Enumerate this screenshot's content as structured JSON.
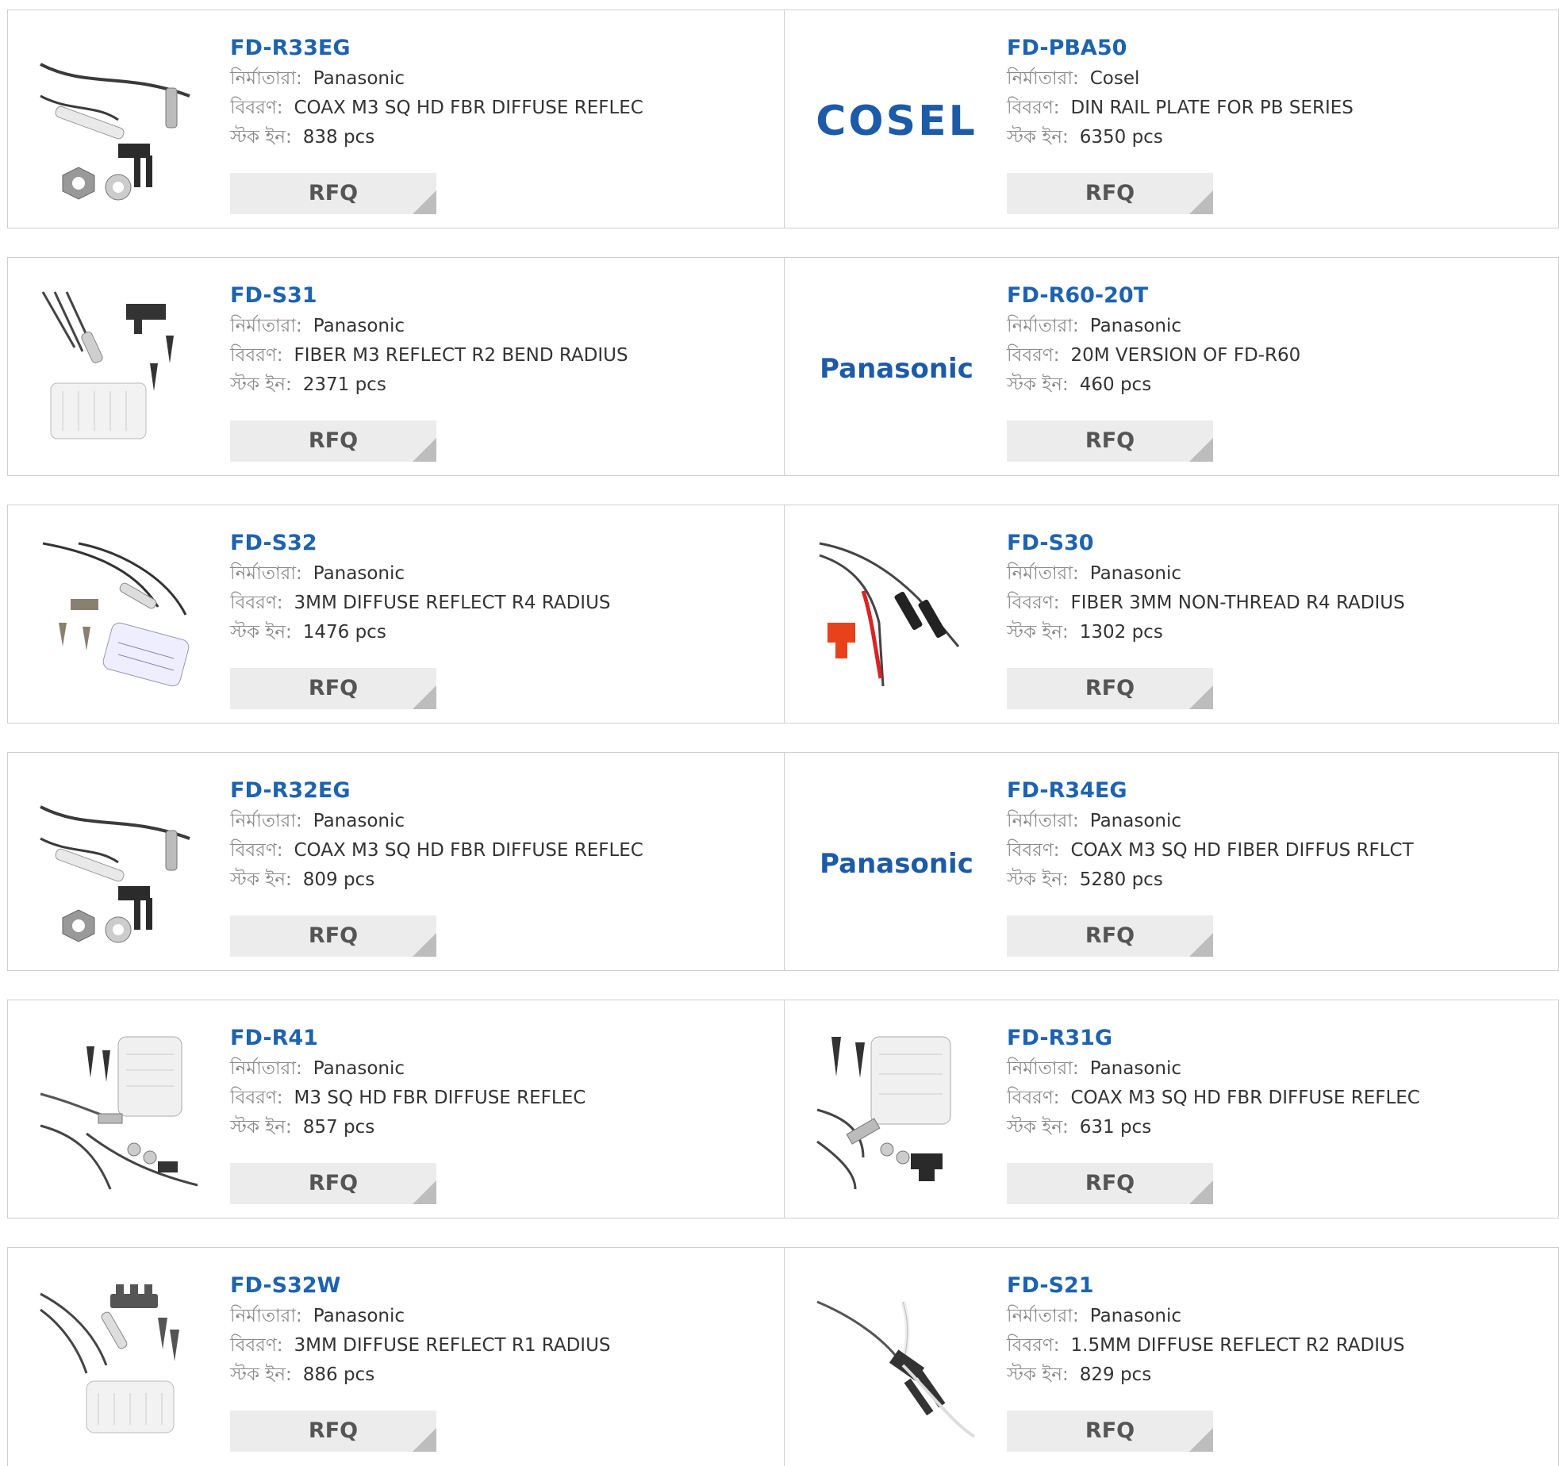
{
  "labels": {
    "manufacturer": "নির্মাতারা:",
    "description": "বিবরণ:",
    "stock": "স্টক ইন:"
  },
  "colors": {
    "part_link": "#1e63b0",
    "brand_logo": "#1d5aa8",
    "rfq_bg": "#ececec",
    "border": "#cfcfcf"
  },
  "rows": [
    {
      "left": {
        "part": "FD-R33EG",
        "manufacturer": "Panasonic",
        "description": "COAX M3 SQ HD FBR DIFFUSE REFLEC",
        "stock": "838 pcs",
        "rfq": "RFQ",
        "image": "fiber-cable-bent-head-photo"
      },
      "right": {
        "part": "FD-PBA50",
        "manufacturer": "Cosel",
        "description": "DIN RAIL PLATE FOR PB SERIES",
        "stock": "6350 pcs",
        "rfq": "RFQ",
        "image": "cosel-logo",
        "logo_text": "COSEL"
      }
    },
    {
      "left": {
        "part": "FD-S31",
        "manufacturer": "Panasonic",
        "description": "FIBER M3 REFLECT R2 BEND RADIUS",
        "stock": "2371 pcs",
        "rfq": "RFQ",
        "image": "fiber-kit-photo"
      },
      "right": {
        "part": "FD-R60-20T",
        "manufacturer": "Panasonic",
        "description": "20M VERSION OF FD-R60",
        "stock": "460 pcs",
        "rfq": "RFQ",
        "image": "panasonic-logo",
        "logo_text": "Panasonic"
      }
    },
    {
      "left": {
        "part": "FD-S32",
        "manufacturer": "Panasonic",
        "description": "3MM DIFFUSE REFLECT R4 RADIUS",
        "stock": "1476 pcs",
        "rfq": "RFQ",
        "image": "fiber-kit-photo"
      },
      "right": {
        "part": "FD-S30",
        "manufacturer": "Panasonic",
        "description": "FIBER 3MM NON-THREAD R4 RADIUS",
        "stock": "1302 pcs",
        "rfq": "RFQ",
        "image": "fiber-red-clip-photo"
      }
    },
    {
      "left": {
        "part": "FD-R32EG",
        "manufacturer": "Panasonic",
        "description": "COAX M3 SQ HD FBR DIFFUSE REFLEC",
        "stock": "809 pcs",
        "rfq": "RFQ",
        "image": "fiber-cable-bent-head-photo"
      },
      "right": {
        "part": "FD-R34EG",
        "manufacturer": "Panasonic",
        "description": "COAX M3 SQ HD FIBER DIFFUS RFLCT",
        "stock": "5280 pcs",
        "rfq": "RFQ",
        "image": "panasonic-logo",
        "logo_text": "Panasonic"
      }
    },
    {
      "left": {
        "part": "FD-R41",
        "manufacturer": "Panasonic",
        "description": "M3 SQ HD FBR DIFFUSE REFLEC",
        "stock": "857 pcs",
        "rfq": "RFQ",
        "image": "fiber-kit-case-photo"
      },
      "right": {
        "part": "FD-R31G",
        "manufacturer": "Panasonic",
        "description": "COAX M3 SQ HD FBR DIFFUSE REFLEC",
        "stock": "631 pcs",
        "rfq": "RFQ",
        "image": "fiber-kit-case-photo"
      }
    },
    {
      "left": {
        "part": "FD-S32W",
        "manufacturer": "Panasonic",
        "description": "3MM DIFFUSE REFLECT R1 RADIUS",
        "stock": "886 pcs",
        "rfq": "RFQ",
        "image": "fiber-kit-photo"
      },
      "right": {
        "part": "FD-S21",
        "manufacturer": "Panasonic",
        "description": "1.5MM DIFFUSE REFLECT R2 RADIUS",
        "stock": "829 pcs",
        "rfq": "RFQ",
        "image": "fiber-white-cable-photo"
      }
    }
  ]
}
